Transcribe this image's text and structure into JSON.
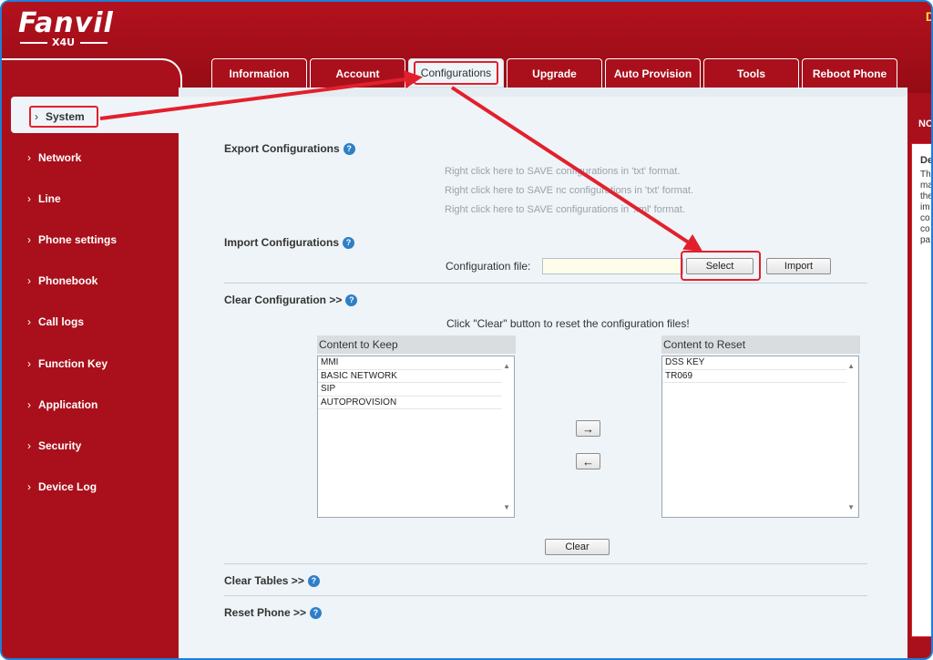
{
  "header": {
    "logo_text": "Fanvil",
    "model": "X4U",
    "corner_text": "D"
  },
  "tabs": [
    {
      "label": "Information"
    },
    {
      "label": "Account"
    },
    {
      "label": "Configurations"
    },
    {
      "label": "Upgrade"
    },
    {
      "label": "Auto Provision"
    },
    {
      "label": "Tools"
    },
    {
      "label": "Reboot Phone"
    }
  ],
  "sidebar": {
    "active": "System",
    "items": [
      {
        "label": "Network"
      },
      {
        "label": "Line"
      },
      {
        "label": "Phone settings"
      },
      {
        "label": "Phonebook"
      },
      {
        "label": "Call logs"
      },
      {
        "label": "Function Key"
      },
      {
        "label": "Application"
      },
      {
        "label": "Security"
      },
      {
        "label": "Device Log"
      }
    ]
  },
  "export": {
    "title": "Export Configurations",
    "links": [
      "Right click here to SAVE configurations in 'txt' format.",
      "Right click here to SAVE nc configurations in 'txt' format.",
      "Right click here to SAVE configurations in 'xml' format."
    ]
  },
  "import": {
    "title": "Import Configurations",
    "file_label": "Configuration file:",
    "file_value": "",
    "select_label": "Select",
    "import_label": "Import"
  },
  "clear_config": {
    "title": "Clear Configuration >>",
    "instruction": "Click \"Clear\" button to reset the configuration files!",
    "keep_header": "Content to Keep",
    "keep_items": [
      "MMI",
      "BASIC NETWORK",
      "SIP",
      "AUTOPROVISION"
    ],
    "reset_header": "Content to Reset",
    "reset_items": [
      "DSS KEY",
      "TR069"
    ],
    "move_right": "→",
    "move_left": "←",
    "clear_label": "Clear"
  },
  "clear_tables": {
    "title": "Clear Tables >>"
  },
  "reset_phone": {
    "title": "Reset Phone >>"
  },
  "right_panel": {
    "head": "NC",
    "title": "De",
    "lines": [
      "Th",
      "ma",
      "the",
      "im",
      "co",
      "co",
      "pa"
    ]
  },
  "help_icon": "?",
  "colors": {
    "brand_red": "#a9101c",
    "highlight": "#e2202d",
    "panel_bg": "#eef4f8"
  }
}
